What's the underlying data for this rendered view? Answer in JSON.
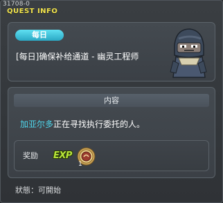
{
  "window": {
    "quest_id": "31708-0",
    "title": "QUEST INFO"
  },
  "quest": {
    "badge": "每日",
    "name": "[每日]确保补给通道 - 幽灵工程师"
  },
  "content": {
    "header": "内容",
    "npc_name": "加亚尔多",
    "description_rest": "正在寻找执行委托的人。"
  },
  "reward": {
    "label": "奖励",
    "exp_label": "EXP",
    "item_quantity": "1",
    "item_icon": "coin-medal-icon"
  },
  "status": {
    "text": "狀態：可開始"
  },
  "colors": {
    "title": "#f2e44b",
    "badge": "#2aa8c4",
    "npc_name": "#4fd6ec",
    "exp": "#b8e63a"
  }
}
